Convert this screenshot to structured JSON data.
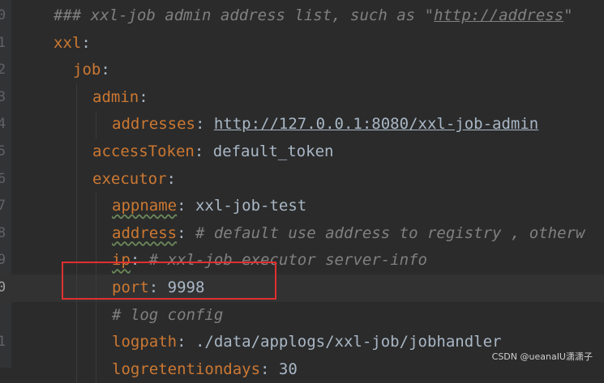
{
  "editor": {
    "lines": [
      {
        "num": "0",
        "indent": 0,
        "parts": [
          {
            "t": "### xxl-job admin address list, such as ",
            "c": "comment"
          },
          {
            "t": "\"",
            "c": "comment"
          },
          {
            "t": "http://address",
            "c": "comment comment-url"
          },
          {
            "t": "\"",
            "c": "comment"
          }
        ]
      },
      {
        "num": "1",
        "indent": 0,
        "parts": [
          {
            "t": "xxl",
            "c": "key"
          },
          {
            "t": ":",
            "c": "punct"
          }
        ]
      },
      {
        "num": "2",
        "indent": 1,
        "parts": [
          {
            "t": "job",
            "c": "key"
          },
          {
            "t": ":",
            "c": "punct"
          }
        ]
      },
      {
        "num": "3",
        "indent": 2,
        "parts": [
          {
            "t": "admin",
            "c": "key"
          },
          {
            "t": ":",
            "c": "punct"
          }
        ]
      },
      {
        "num": "4",
        "indent": 3,
        "parts": [
          {
            "t": "addresses",
            "c": "key"
          },
          {
            "t": ": ",
            "c": "punct"
          },
          {
            "t": "http://127.0.0.1:8080/xxl-job-admin",
            "c": "url"
          }
        ]
      },
      {
        "num": "5",
        "indent": 2,
        "parts": [
          {
            "t": "accessToken",
            "c": "key"
          },
          {
            "t": ": ",
            "c": "punct"
          },
          {
            "t": "default_token",
            "c": "val"
          }
        ]
      },
      {
        "num": "6",
        "indent": 2,
        "parts": [
          {
            "t": "executor",
            "c": "key"
          },
          {
            "t": ":",
            "c": "punct"
          }
        ]
      },
      {
        "num": "7",
        "indent": 3,
        "parts": [
          {
            "t": "appname",
            "c": "key typo"
          },
          {
            "t": ": ",
            "c": "punct"
          },
          {
            "t": "xxl-job-test",
            "c": "val"
          }
        ]
      },
      {
        "num": "8",
        "indent": 3,
        "parts": [
          {
            "t": "address",
            "c": "key typo"
          },
          {
            "t": ": ",
            "c": "punct"
          },
          {
            "t": "# default use address to registry , otherw",
            "c": "comment"
          }
        ]
      },
      {
        "num": "9",
        "indent": 3,
        "parts": [
          {
            "t": "ip",
            "c": "key typo"
          },
          {
            "t": ": ",
            "c": "punct"
          },
          {
            "t": "# xxl-job executor server-info",
            "c": "comment"
          }
        ]
      },
      {
        "num": "0",
        "indent": 3,
        "current": true,
        "parts": [
          {
            "t": "port",
            "c": "key"
          },
          {
            "t": ": ",
            "c": "punct"
          },
          {
            "t": "9998",
            "c": "val"
          }
        ]
      },
      {
        "num": "",
        "indent": 3,
        "parts": [
          {
            "t": "# log config",
            "c": "comment"
          }
        ]
      },
      {
        "num": "1",
        "indent": 3,
        "parts": [
          {
            "t": "logpath",
            "c": "key"
          },
          {
            "t": ": ",
            "c": "punct"
          },
          {
            "t": "./data/applogs/xxl-job/jobhandler",
            "c": "val"
          }
        ]
      },
      {
        "num": "",
        "indent": 3,
        "parts": [
          {
            "t": "logretentiondays",
            "c": "key"
          },
          {
            "t": ": ",
            "c": "punct"
          },
          {
            "t": "30",
            "c": "val"
          }
        ]
      }
    ]
  },
  "watermark": "CSDN @ueanaIU潇潇子",
  "colors": {
    "background": "#2b2b2b",
    "key": "#cc7832",
    "comment": "#808080",
    "highlight_box": "#e0302f"
  }
}
